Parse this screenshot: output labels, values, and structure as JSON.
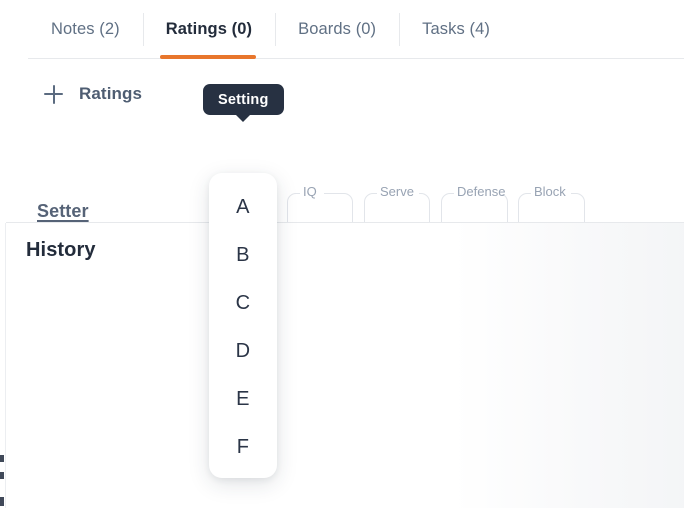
{
  "tabs": [
    {
      "label": "Notes (2)",
      "active": false
    },
    {
      "label": "Ratings (0)",
      "active": true
    },
    {
      "label": "Boards (0)",
      "active": false
    },
    {
      "label": "Tasks (4)",
      "active": false
    }
  ],
  "ratings": {
    "add_label": "Ratings",
    "add_icon": "plus-icon",
    "row_link": "Setter",
    "tooltip": "Setting",
    "fields": [
      {
        "label": "Setting",
        "value": "",
        "focused": true
      },
      {
        "label": "IQ",
        "value": "",
        "focused": false
      },
      {
        "label": "Serve",
        "value": "",
        "focused": false
      },
      {
        "label": "Defense",
        "value": "",
        "focused": false
      },
      {
        "label": "Block",
        "value": "",
        "focused": false
      }
    ]
  },
  "dropdown": {
    "open": true,
    "options": [
      "A",
      "B",
      "C",
      "D",
      "E",
      "F"
    ]
  },
  "history": {
    "title": "History"
  },
  "colors": {
    "accent": "#e8762c",
    "tooltip_bg": "#273142",
    "text_dark": "#232c3b",
    "text_muted": "#607084",
    "border": "#e7e9ec"
  }
}
